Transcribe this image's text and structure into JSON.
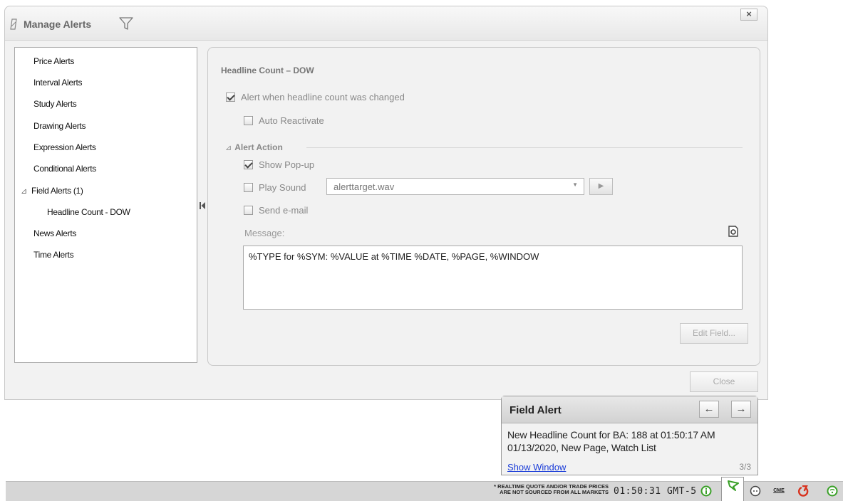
{
  "dialog": {
    "title": "Manage Alerts",
    "close_glyph": "×",
    "close_button": "Close"
  },
  "sidebar": {
    "items": [
      {
        "label": "Price Alerts"
      },
      {
        "label": "Interval Alerts"
      },
      {
        "label": "Study Alerts"
      },
      {
        "label": "Drawing Alerts"
      },
      {
        "label": "Expression Alerts"
      },
      {
        "label": "Conditional Alerts"
      },
      {
        "label": "Field Alerts (1)",
        "expanded": true
      },
      {
        "label": "Headline Count - DOW",
        "child": true
      },
      {
        "label": "News Alerts"
      },
      {
        "label": "Time Alerts"
      }
    ]
  },
  "detail": {
    "title": "Headline Count – DOW",
    "alert_when_label": "Alert when headline count was changed",
    "alert_when_checked": true,
    "auto_reactivate_label": "Auto Reactivate",
    "auto_reactivate_checked": false,
    "alert_action_label": "Alert Action",
    "show_popup_label": "Show Pop-up",
    "show_popup_checked": true,
    "play_sound_label": "Play Sound",
    "play_sound_checked": false,
    "sound_file": "alerttarget.wav",
    "send_email_label": "Send e-mail",
    "send_email_checked": false,
    "message_label": "Message:",
    "message_value": "%TYPE for %SYM: %VALUE at %TIME %DATE, %PAGE, %WINDOW",
    "edit_field_button": "Edit Field..."
  },
  "popup": {
    "title": "Field Alert",
    "back_glyph": "←",
    "forward_glyph": "→",
    "message": "New Headline Count for BA: 188 at 01:50:17 AM 01/13/2020, New Page, Watch List",
    "link": "Show Window",
    "counter": "3/3"
  },
  "statusbar": {
    "realtime_note_line1": "* REALTIME QUOTE AND/OR TRADE PRICES",
    "realtime_note_line2": "ARE NOT SOURCED FROM ALL MARKETS",
    "clock": "01:50:31 GMT-5",
    "cme_label": "CME"
  },
  "colors": {
    "link": "#1a3cd8",
    "status_green": "#3aa028",
    "status_red": "#d8321e"
  }
}
